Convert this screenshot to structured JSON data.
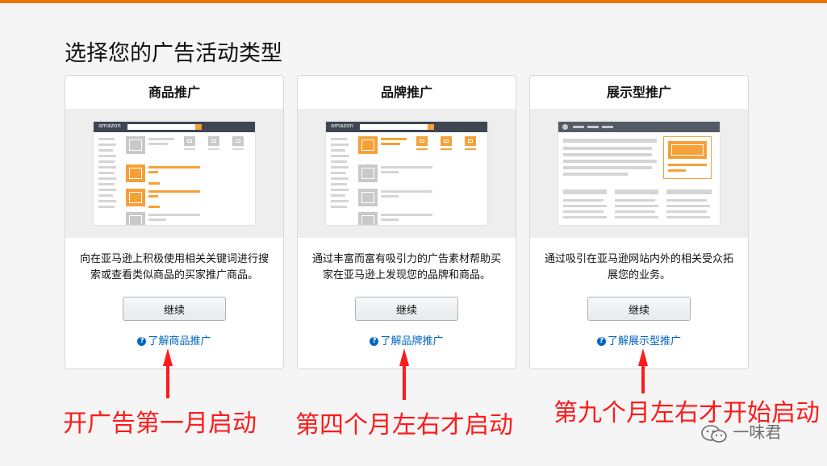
{
  "page": {
    "heading": "选择您的广告活动类型"
  },
  "cards": [
    {
      "title": "商品推广",
      "description": "向在亚马逊上积极使用相关关键词进行搜索或查看类似商品的买家推广商品。",
      "button": "继续",
      "learn_more": "了解商品推广"
    },
    {
      "title": "品牌推广",
      "description": "通过丰富而富有吸引力的广告素材帮助买家在亚马逊上发现您的品牌和商品。",
      "button": "继续",
      "learn_more": "了解品牌推广"
    },
    {
      "title": "展示型推广",
      "description": "通过吸引在亚马逊网站内外的相关受众拓展您的业务。",
      "button": "继续",
      "learn_more": "了解展示型推广"
    }
  ],
  "annotations": [
    "开广告第一月启动",
    "第四个月左右才启动",
    "第九个月左右才开始启动"
  ],
  "mock": {
    "brand": "amazon"
  },
  "watermark": "一味君",
  "colors": {
    "accent": "#e77600",
    "link": "#0066c0",
    "annotation": "#ff1a1a"
  }
}
